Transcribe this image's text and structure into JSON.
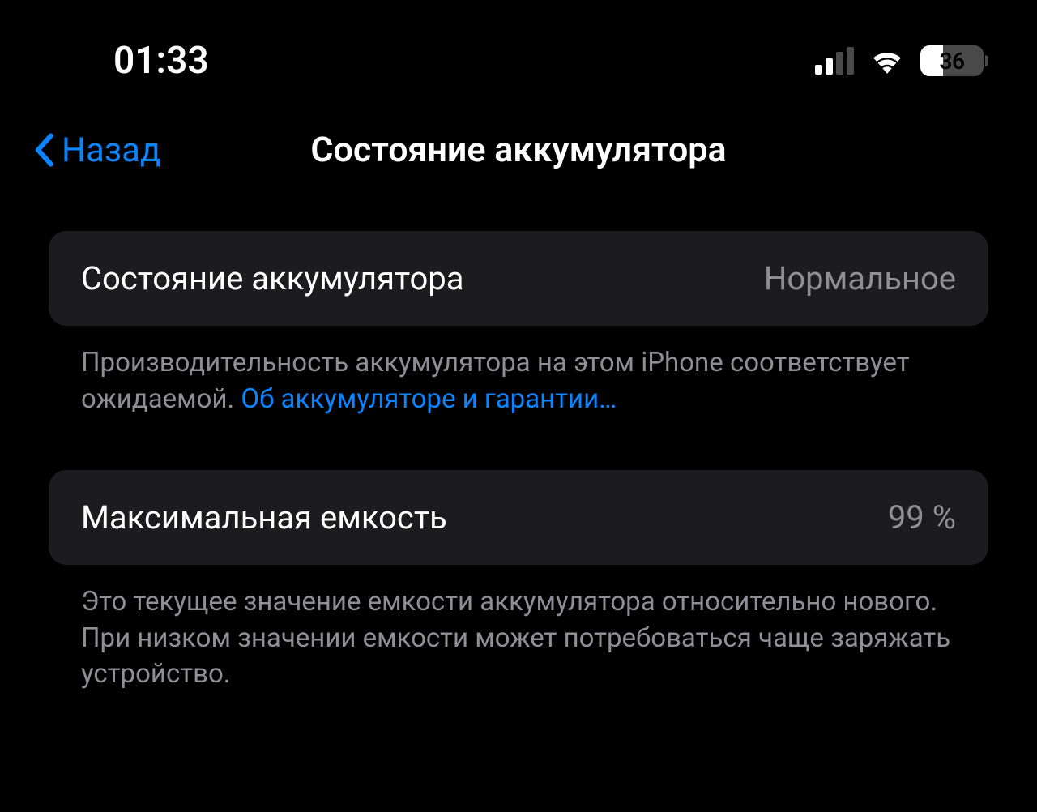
{
  "statusBar": {
    "time": "01:33",
    "batteryPercent": "36"
  },
  "nav": {
    "backLabel": "Назад",
    "title": "Состояние аккумулятора"
  },
  "section1": {
    "label": "Состояние аккумулятора",
    "value": "Нормальное",
    "footer": "Производительность аккумулятора на этом iPhone соответствует ожидаемой. ",
    "footerLink": "Об аккумуляторе и гарантии…"
  },
  "section2": {
    "label": "Максимальная емкость",
    "value": "99 %",
    "footer": "Это текущее значение емкости аккумулятора относительно нового. При низком значении емкости может потребоваться чаще заряжать устройство."
  }
}
